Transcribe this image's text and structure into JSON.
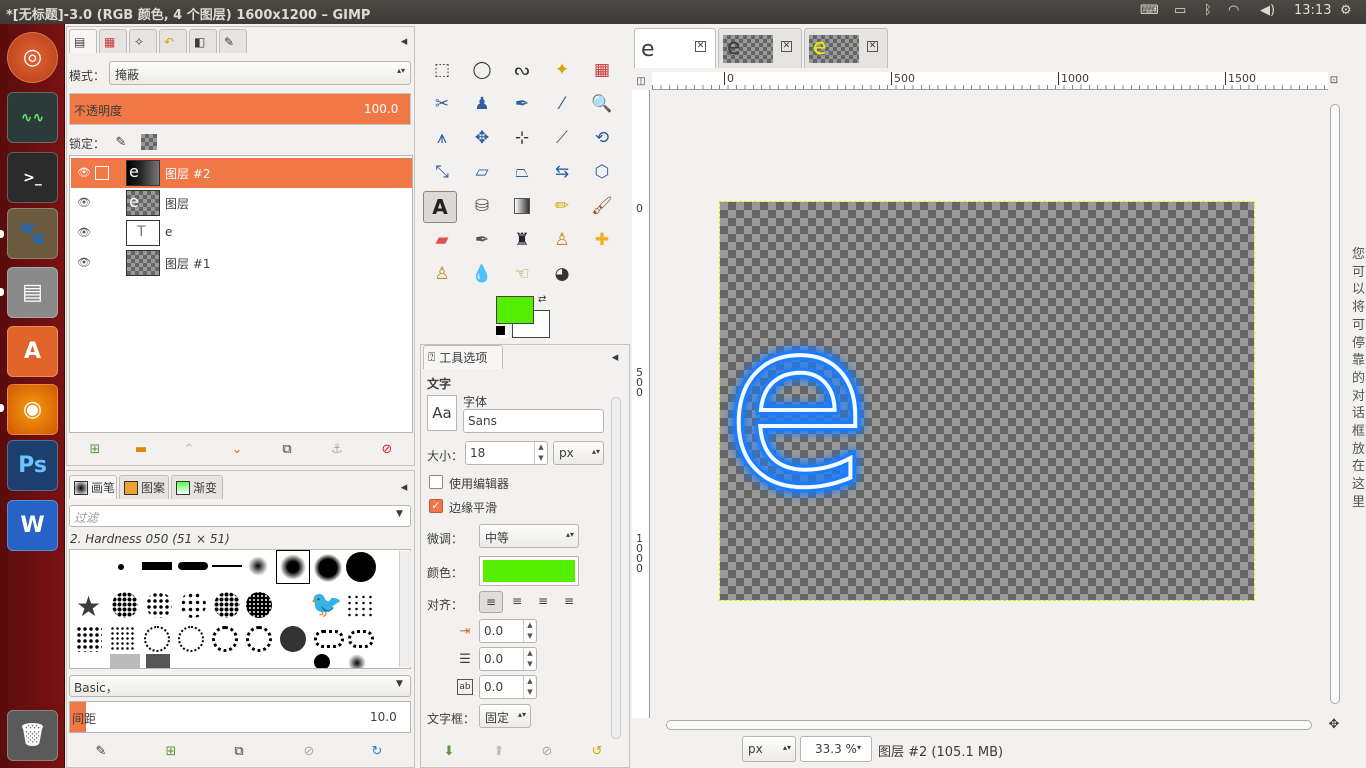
{
  "window": {
    "title": "*[无标题]-3.0 (RGB 颜色, 4 个图层) 1600x1200 – GIMP",
    "clock": "13:13"
  },
  "layers_panel": {
    "mode_label": "模式：",
    "mode_value": "掩蔽",
    "opacity_label": "不透明度",
    "opacity_value": "100.0",
    "lock_label": "锁定：",
    "layers": [
      {
        "name": "图层 #2",
        "selected": true
      },
      {
        "name": "图层",
        "selected": false
      },
      {
        "name": "e",
        "selected": false
      },
      {
        "name": "图层 #1",
        "selected": false
      }
    ]
  },
  "brushes_panel": {
    "tabs": [
      "画笔",
      "图案",
      "渐变"
    ],
    "filter_placeholder": "过滤",
    "brush_name": "2. Hardness 050 (51 × 51)",
    "tag_value": "Basic，",
    "spacing_label": "间距",
    "spacing_value": "10.0"
  },
  "tool_options": {
    "tab_label": "工具选项",
    "section": "文字",
    "font_label": "字体",
    "font_preview": "Aa",
    "font_value": "Sans",
    "size_label": "大小：",
    "size_value": "18",
    "size_unit": "px",
    "use_editor": "使用编辑器",
    "antialias": "边缘平滑",
    "hinting_label": "微调：",
    "hinting_value": "中等",
    "color_label": "颜色：",
    "color_hex": "#55ee00",
    "justify_label": "对齐：",
    "indent": "0.0",
    "line_spacing": "0.0",
    "letter_spacing": "0.0",
    "box_label": "文字框：",
    "box_value": "固定"
  },
  "image_tabs": [
    {
      "label": "e"
    },
    {
      "label": "e"
    },
    {
      "label": "e"
    }
  ],
  "rulers": {
    "h": [
      "0",
      "500",
      "1000",
      "1500"
    ],
    "v": [
      "0",
      "500",
      "1000"
    ]
  },
  "statusbar": {
    "unit": "px",
    "zoom": "33.3 %",
    "info": "图层 #2 (105.1 MB)"
  },
  "side_hint": [
    "您",
    "可",
    "以",
    "将",
    "可",
    "停",
    "靠",
    "的",
    "对",
    "话",
    "框",
    "放",
    "在",
    "这",
    "里"
  ],
  "colors": {
    "fg": "#55ee00",
    "bg": "#ffffff",
    "accent": "#f07746"
  }
}
